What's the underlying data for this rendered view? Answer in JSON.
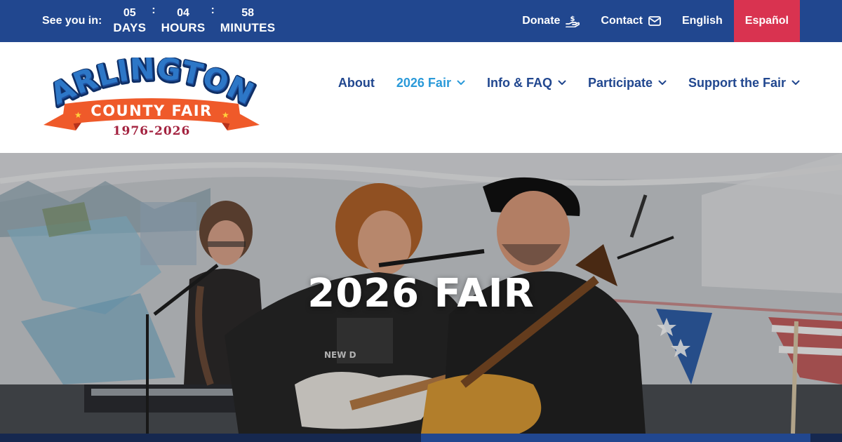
{
  "topbar": {
    "countdown": {
      "prefix": "See you in:",
      "days": {
        "value": "05",
        "label": "DAYS"
      },
      "hours": {
        "value": "04",
        "label": "HOURS"
      },
      "minutes": {
        "value": "58",
        "label": "MINUTES"
      },
      "separator": ":"
    },
    "links": {
      "donate": {
        "label": "Donate",
        "icon": "donate-hand-icon"
      },
      "contact": {
        "label": "Contact",
        "icon": "envelope-icon"
      },
      "english": {
        "label": "English"
      },
      "espanol": {
        "label": "Español"
      }
    }
  },
  "logo": {
    "line1": "ARLINGTON",
    "line2": "COUNTY FAIR",
    "years": "1976-2026"
  },
  "nav": {
    "about": {
      "label": "About"
    },
    "fair": {
      "label": "2026 Fair",
      "icon": "chevron-down-icon"
    },
    "info": {
      "label": "Info & FAQ",
      "icon": "chevron-down-icon"
    },
    "participate": {
      "label": "Participate",
      "icon": "chevron-down-icon"
    },
    "support": {
      "label": "Support the Fair",
      "icon": "chevron-down-icon"
    }
  },
  "hero": {
    "title": "2026 FAIR",
    "image": "band-performing-photo"
  },
  "colors": {
    "topbar": "#21478f",
    "espanol": "#d93350",
    "nav": "#21478f",
    "nav_active": "#2b9ad9",
    "ribbon": "#ef5a2a",
    "years": "#a3223f"
  }
}
